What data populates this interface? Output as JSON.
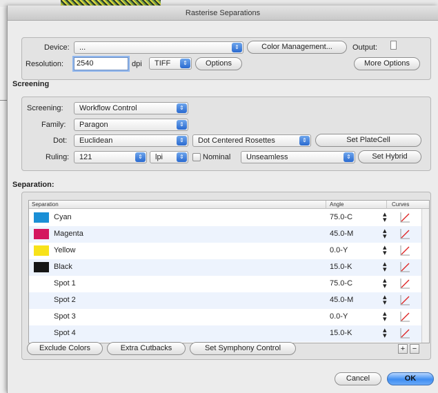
{
  "window": {
    "title": "Rasterise Separations"
  },
  "output_options": {
    "device_label": "Device:",
    "device_value": "...",
    "color_management_button": "Color Management...",
    "output_label": "Output:",
    "resolution_label": "Resolution:",
    "resolution_value": "2540",
    "dpi_label": "dpi",
    "format_value": "TIFF",
    "options_button": "Options",
    "more_options_button": "More Options"
  },
  "screening": {
    "section_title": "Screening",
    "screening_label": "Screening:",
    "screening_value": "Workflow Control",
    "family_label": "Family:",
    "family_value": "Paragon",
    "dot_label": "Dot:",
    "dot_value": "Euclidean",
    "dot_style_value": "Dot Centered Rosettes",
    "set_platecell_button": "Set PlateCell",
    "ruling_label": "Ruling:",
    "ruling_value": "121",
    "ruling_unit_value": "lpi",
    "nominal_label": "Nominal",
    "seam_value": "Unseamless",
    "set_hybrid_button": "Set Hybrid"
  },
  "separation": {
    "section_title": "Separation:",
    "columns": {
      "separation": "Separation",
      "angle": "Angle",
      "curves": "Curves"
    },
    "rows": [
      {
        "name": "Cyan",
        "angle": "75.0-C",
        "color": "#1a8fd6"
      },
      {
        "name": "Magenta",
        "angle": "45.0-M",
        "color": "#d4165f"
      },
      {
        "name": "Yellow",
        "angle": "0.0-Y",
        "color": "#f7e21a"
      },
      {
        "name": "Black",
        "angle": "15.0-K",
        "color": "#161616"
      },
      {
        "name": "Spot 1",
        "angle": "75.0-C",
        "color": ""
      },
      {
        "name": "Spot 2",
        "angle": "45.0-M",
        "color": ""
      },
      {
        "name": "Spot 3",
        "angle": "0.0-Y",
        "color": ""
      },
      {
        "name": "Spot 4",
        "angle": "15.0-K",
        "color": ""
      }
    ],
    "exclude_colors_button": "Exclude Colors",
    "extra_cutbacks_button": "Extra Cutbacks",
    "symphony_button": "Set Symphony Control",
    "add_button": "+",
    "remove_button": "−"
  },
  "footer": {
    "cancel_button": "Cancel",
    "ok_button": "OK"
  },
  "icons": {
    "popup_arrow": "up-down-arrows-icon",
    "curve": "curve-graph-icon",
    "stepper": "stepper-icon"
  }
}
